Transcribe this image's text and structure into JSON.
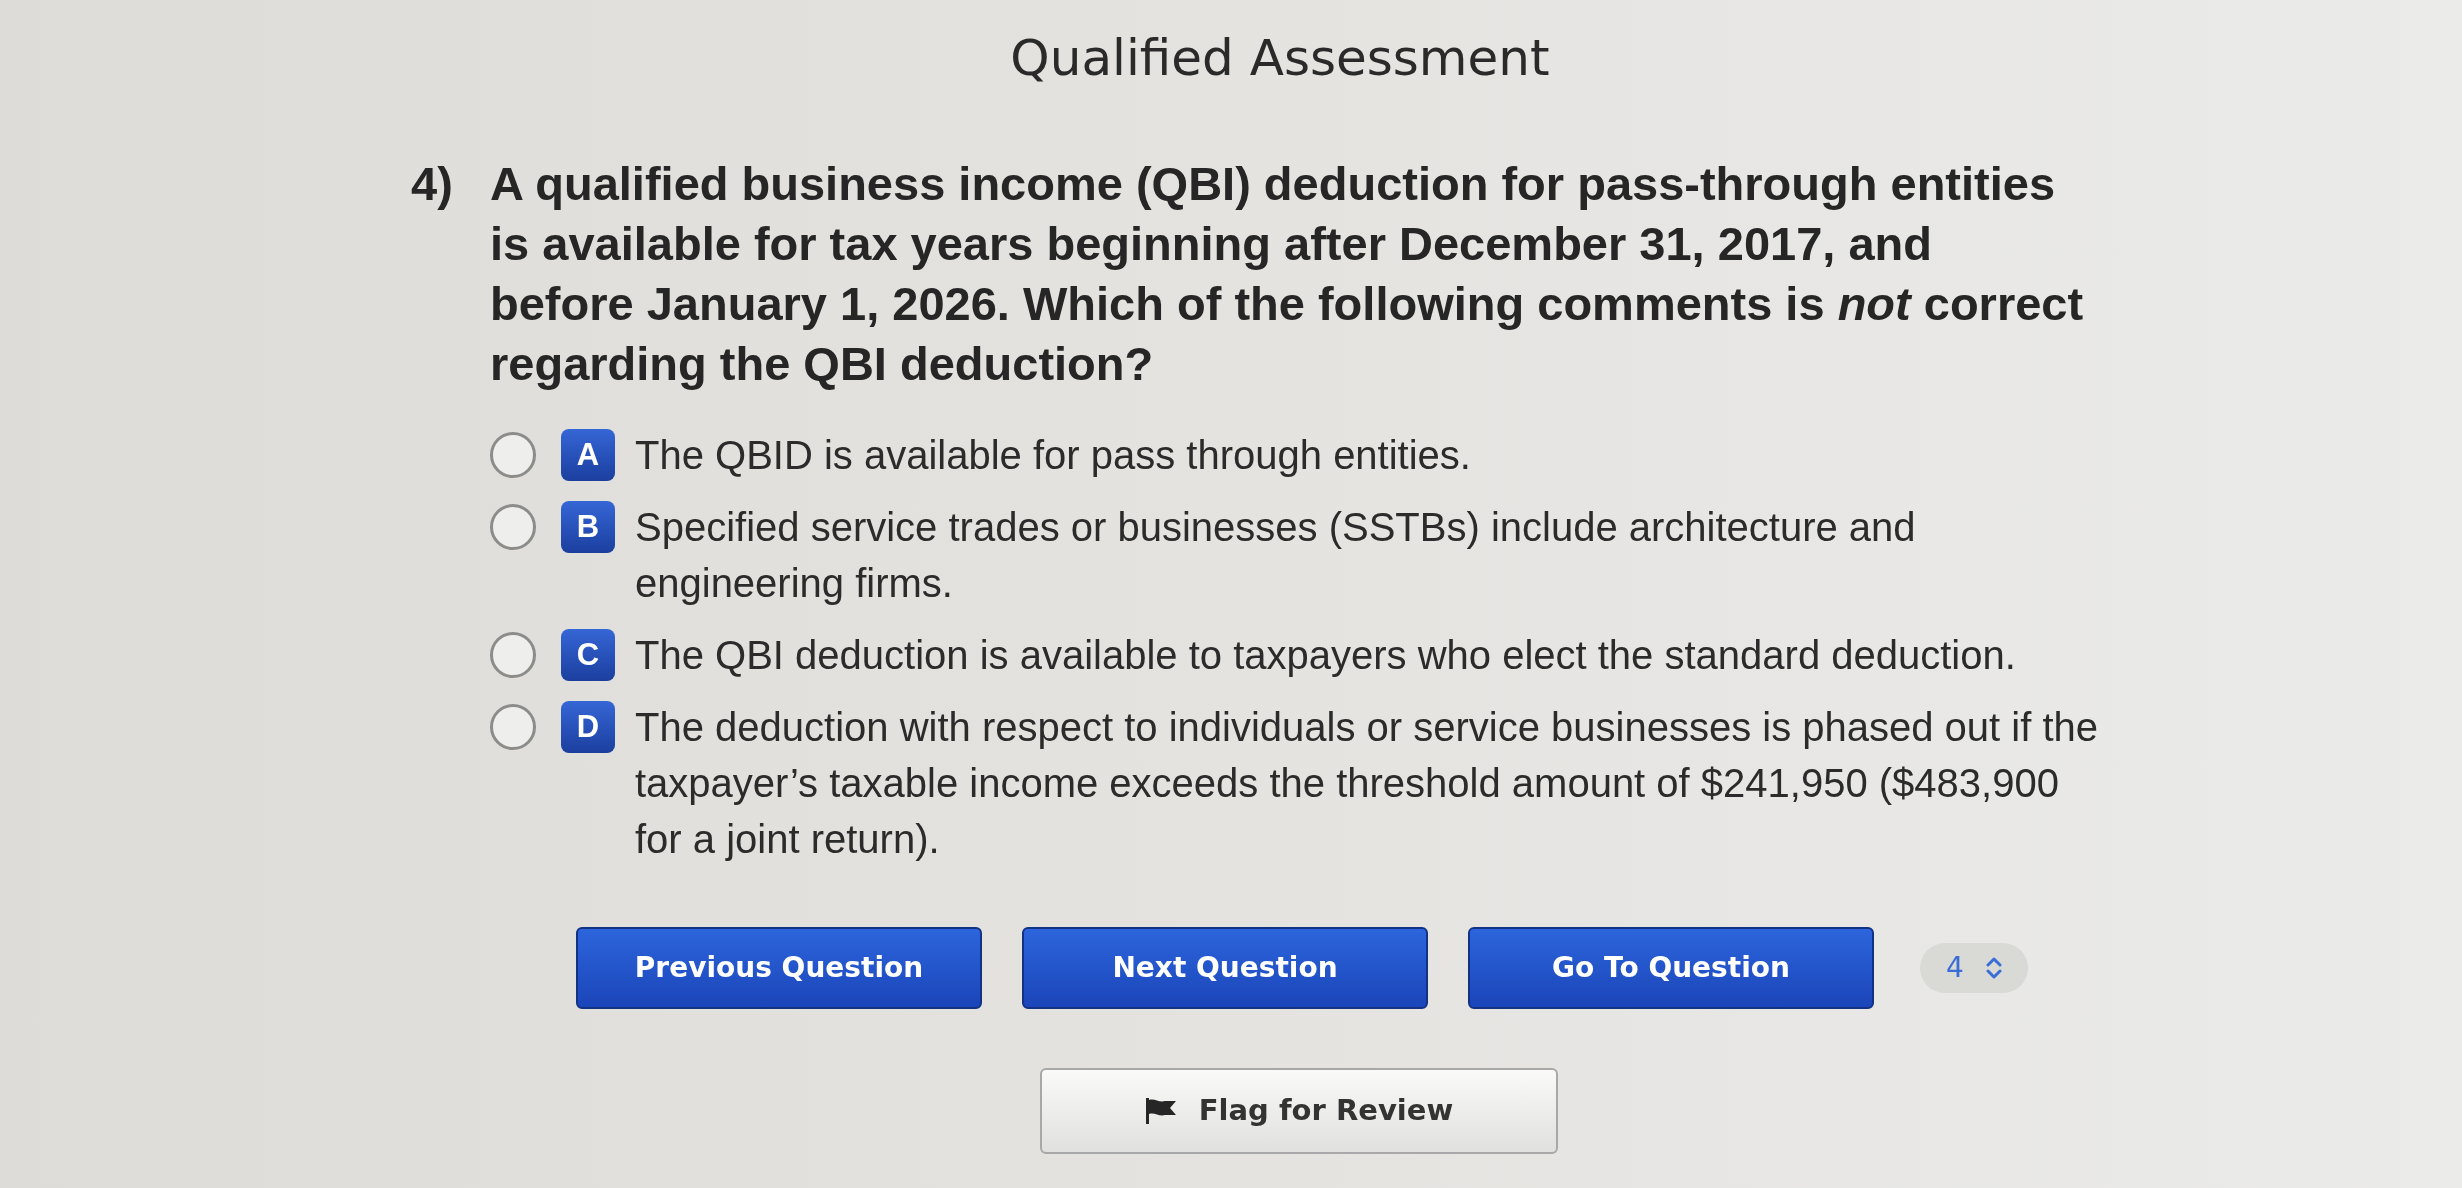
{
  "window": {
    "title": "Qualified Assessment"
  },
  "question": {
    "number": "4)",
    "text": "A qualified business income (QBI) deduction for pass-through entities is available for tax years beginning after December 31, 2017, and before January 1, 2026. Which of the following comments is *not* correct regarding the QBI deduction?"
  },
  "options": [
    {
      "letter": "A",
      "text": "The QBID is available for pass through entities.",
      "selected": false
    },
    {
      "letter": "B",
      "text": "Specified service trades or businesses (SSTBs) include architecture and engineering firms.",
      "selected": false
    },
    {
      "letter": "C",
      "text": "The QBI deduction is available to taxpayers who elect the standard deduction.",
      "selected": false
    },
    {
      "letter": "D",
      "text": "The deduction with respect to individuals or service businesses is phased out if the taxpayer’s taxable income exceeds the threshold amount of $241,950 ($483,900 for a joint return).",
      "selected": false
    }
  ],
  "nav_buttons": [
    {
      "label": "Previous Question"
    },
    {
      "label": "Next Question"
    },
    {
      "label": "Go To Question"
    }
  ],
  "question_select": {
    "value": "4"
  },
  "flag_button": {
    "label": "Flag for Review"
  }
}
